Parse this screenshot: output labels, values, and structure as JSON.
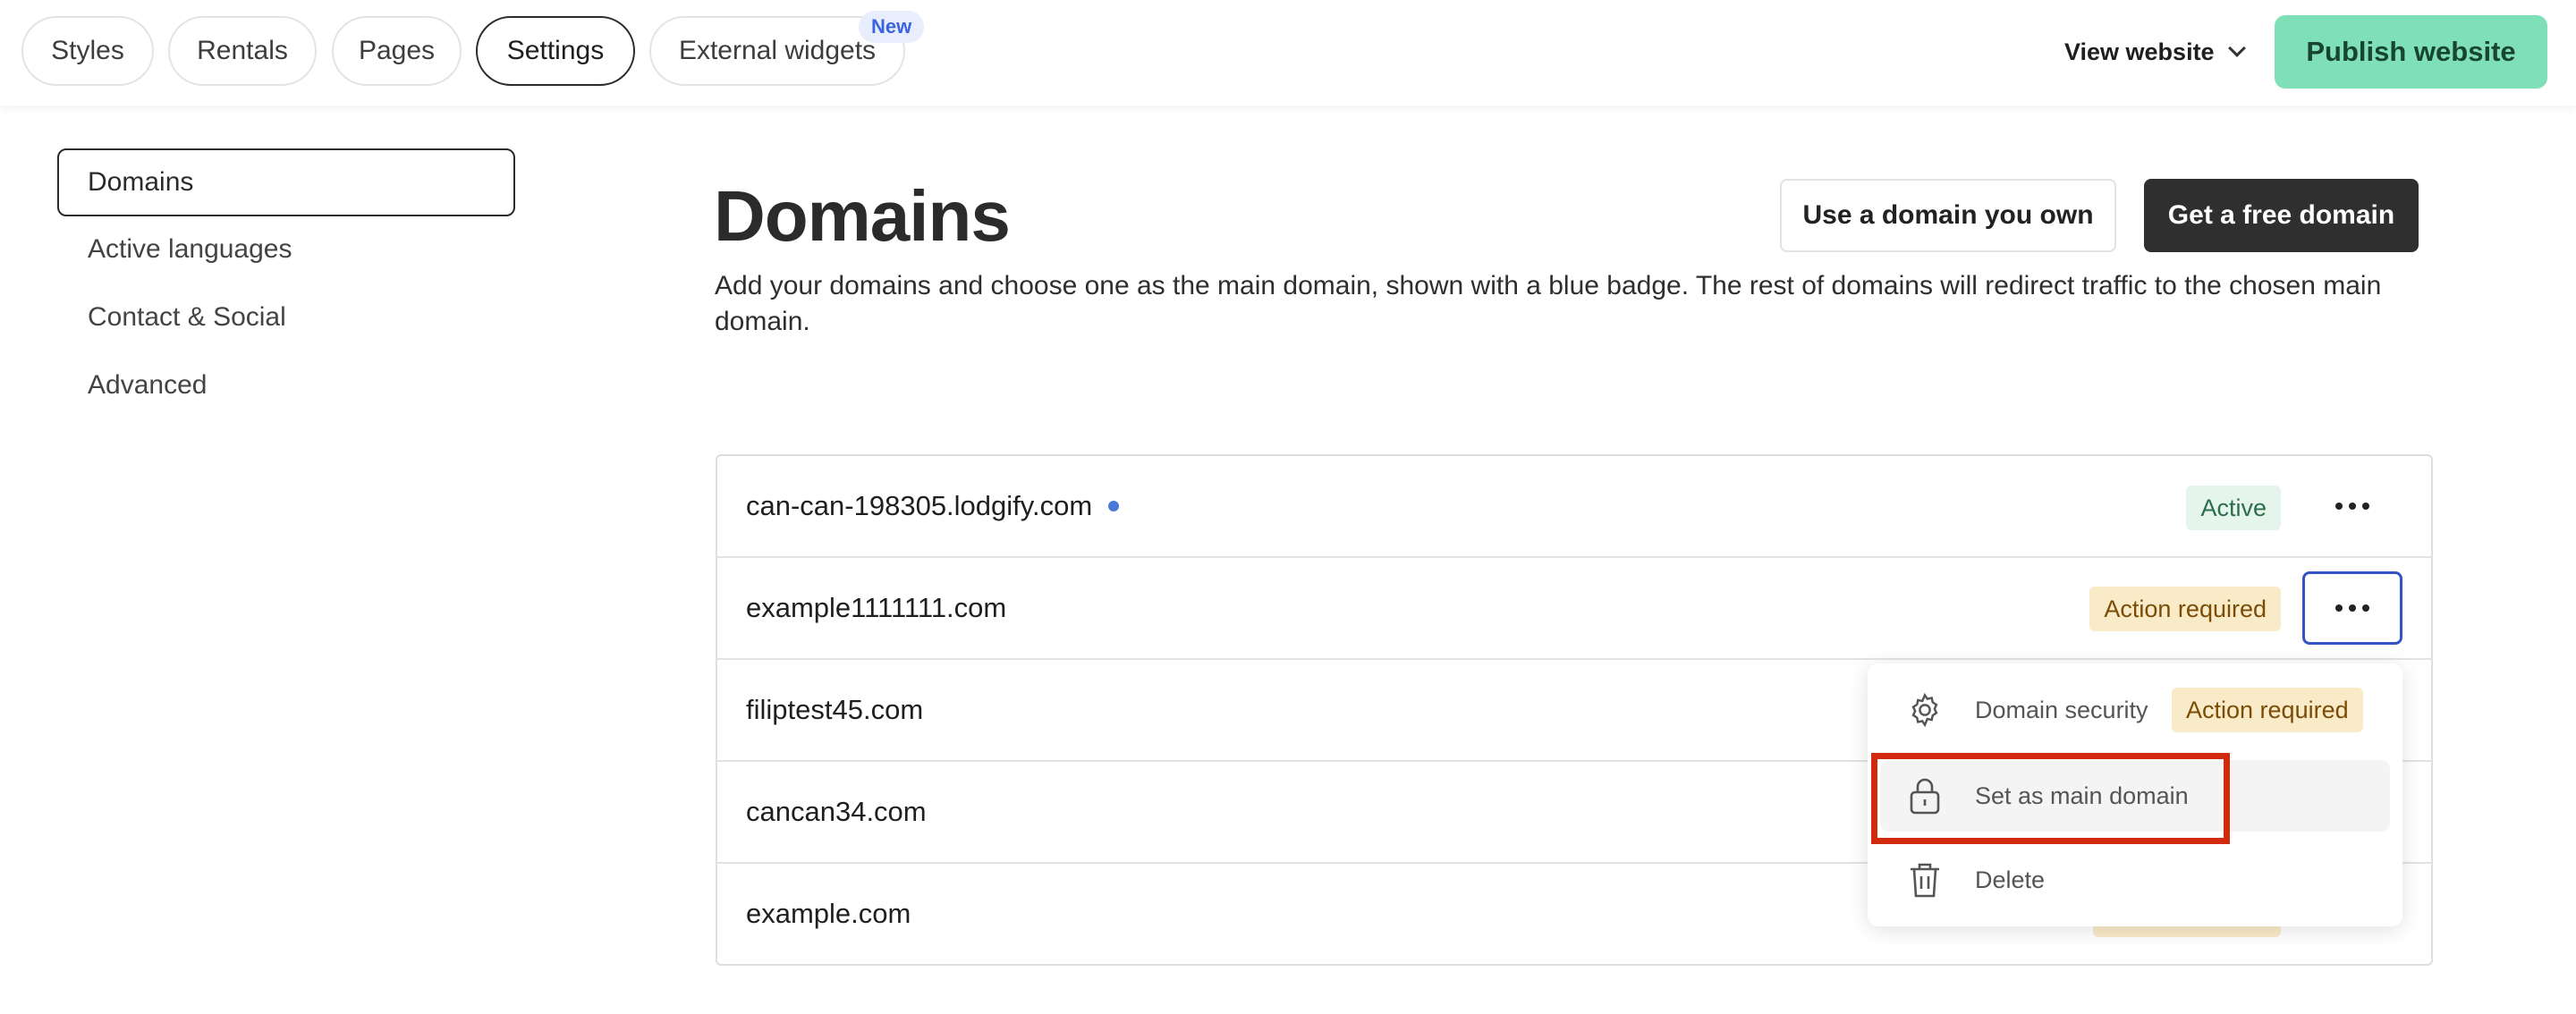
{
  "topbar": {
    "tabs": [
      {
        "label": "Styles"
      },
      {
        "label": "Rentals"
      },
      {
        "label": "Pages"
      },
      {
        "label": "Settings"
      },
      {
        "label": "External widgets"
      }
    ],
    "new_badge": "New",
    "view_website": "View website",
    "publish": "Publish website"
  },
  "sidebar": {
    "items": [
      {
        "label": "Domains"
      },
      {
        "label": "Active languages"
      },
      {
        "label": "Contact & Social"
      },
      {
        "label": "Advanced"
      }
    ]
  },
  "main": {
    "title": "Domains",
    "btn_own": "Use a domain you own",
    "btn_free": "Get a free domain",
    "description": "Add your domains and choose one as the main domain, shown with a blue badge. The rest of domains will redirect traffic to the chosen main domain.",
    "domains": [
      {
        "name": "can-can-198305.lodgify.com",
        "status": "Active"
      },
      {
        "name": "example1111111.com",
        "status": "Action required"
      },
      {
        "name": "filiptest45.com",
        "status": ""
      },
      {
        "name": "cancan34.com",
        "status": ""
      },
      {
        "name": "example.com",
        "status": ""
      }
    ]
  },
  "menu": {
    "items": [
      {
        "label": "Domain security",
        "badge": "Action required",
        "icon": "gear-icon"
      },
      {
        "label": "Set as main domain",
        "icon": "lock-icon"
      },
      {
        "label": "Delete",
        "icon": "trash-icon"
      }
    ]
  },
  "colors": {
    "publish_bg": "#7fe0b8",
    "main_dot": "#4a78d8",
    "highlight": "#d22a0f",
    "focus_border": "#3653c4"
  }
}
